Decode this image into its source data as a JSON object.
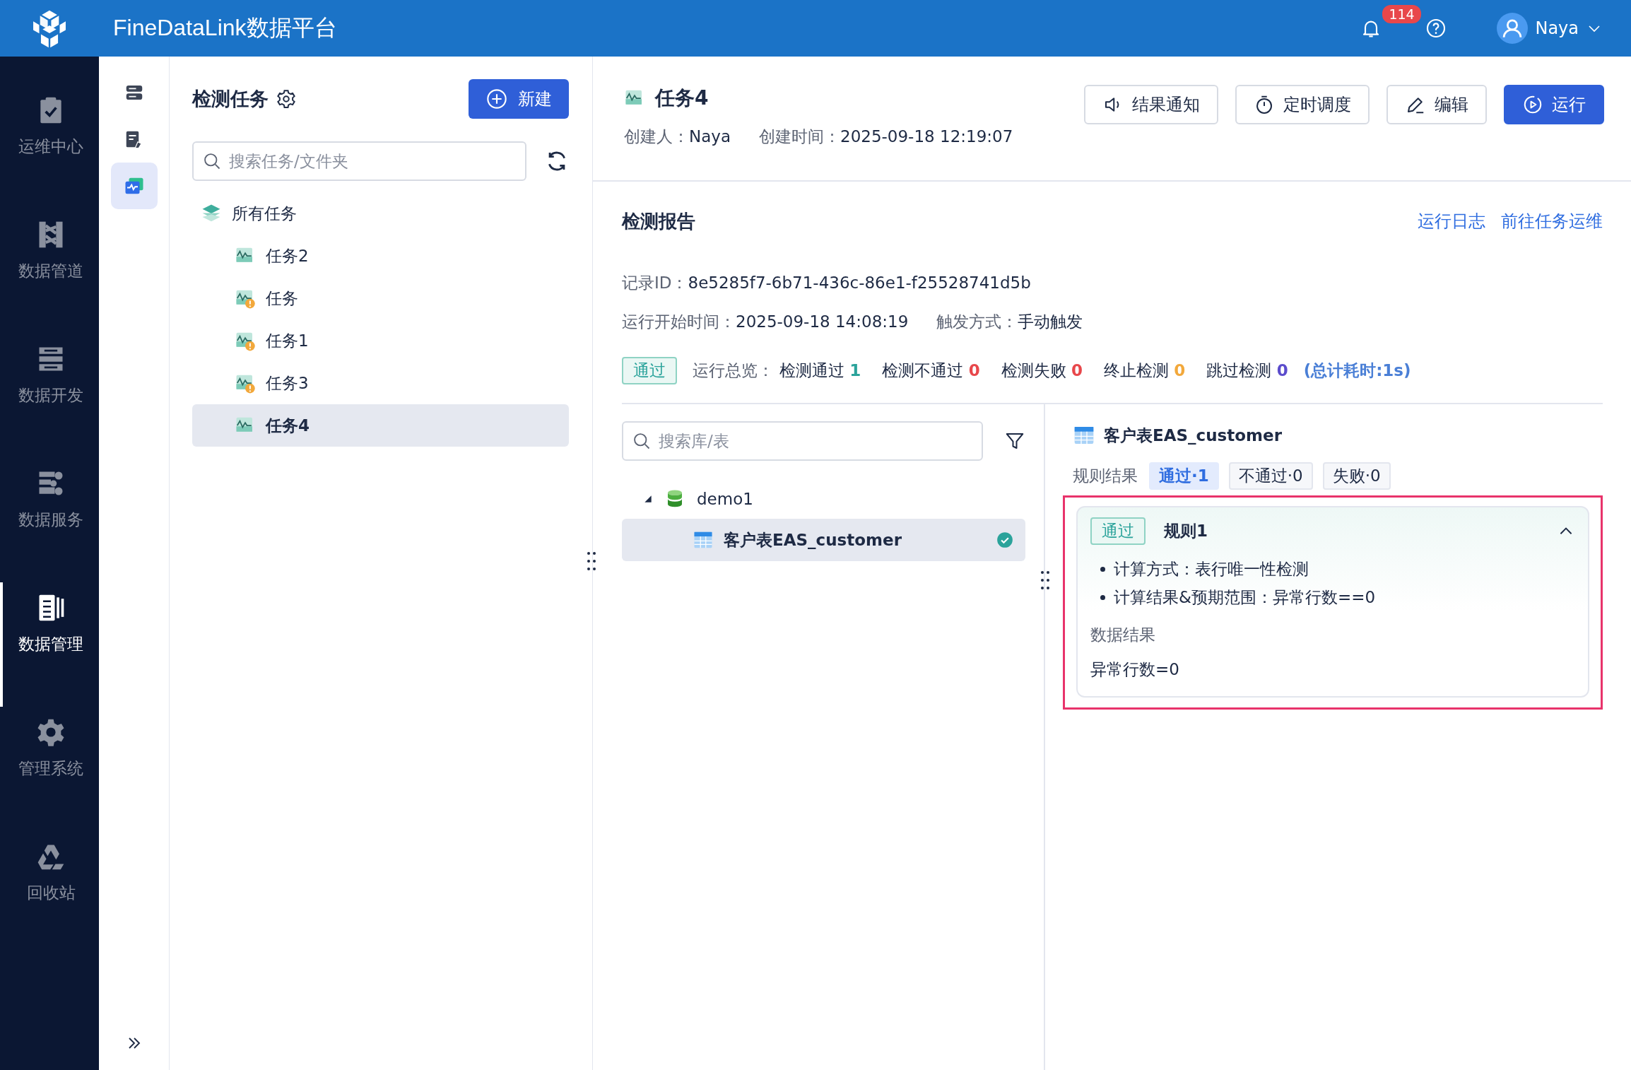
{
  "topbar": {
    "title": "FineDataLink数据平台",
    "notifications": "114",
    "user": "Naya"
  },
  "nav": [
    {
      "label": "运维中心",
      "selected": false
    },
    {
      "label": "数据管道",
      "selected": false
    },
    {
      "label": "数据开发",
      "selected": false
    },
    {
      "label": "数据服务",
      "selected": false
    },
    {
      "label": "数据管理",
      "selected": true
    },
    {
      "label": "管理系统",
      "selected": false
    },
    {
      "label": "回收站",
      "selected": false
    }
  ],
  "subnav": [
    {
      "selected": false
    },
    {
      "selected": false
    },
    {
      "selected": true
    }
  ],
  "task_panel": {
    "title": "检测任务",
    "new_button": "新建",
    "search": {
      "placeholder": "搜索任务/文件夹"
    },
    "tree": {
      "label": "所有任务",
      "children": [
        {
          "label": "任务2",
          "warning": false,
          "selected": false
        },
        {
          "label": "任务",
          "warning": true,
          "selected": false
        },
        {
          "label": "任务1",
          "warning": true,
          "selected": false
        },
        {
          "label": "任务3",
          "warning": true,
          "selected": false
        },
        {
          "label": "任务4",
          "warning": false,
          "selected": true
        }
      ]
    }
  },
  "task": {
    "title": "任务4",
    "meta": [
      {
        "label": "创建人：",
        "value": "Naya"
      },
      {
        "label": "创建时间：",
        "value": "2025-09-18 12:19:07"
      }
    ],
    "buttons": [
      {
        "label": "结果通知",
        "kind": "notify"
      },
      {
        "label": "定时调度",
        "kind": "schedule"
      },
      {
        "label": "编辑",
        "kind": "edit"
      },
      {
        "label": "运行",
        "kind": "run"
      }
    ]
  },
  "report": {
    "title": "检测报告",
    "links": [
      "运行日志",
      "前往任务运维"
    ],
    "fields": [
      [
        {
          "label": "记录ID：",
          "value": "8e5285f7-6b71-436c-86e1-f25528741d5b"
        }
      ],
      [
        {
          "label": "运行开始时间：",
          "value": "2025-09-18 14:08:19"
        },
        {
          "label": "触发方式：",
          "value": "手动触发"
        }
      ]
    ],
    "status": "通过",
    "summary_label": "运行总览：",
    "stats": [
      {
        "label": "检测通过",
        "value": "1",
        "color": "#2ba39b"
      },
      {
        "label": "检测不通过",
        "value": "0",
        "color": "#e8474b"
      },
      {
        "label": "检测失败",
        "value": "0",
        "color": "#e8474b"
      },
      {
        "label": "终止检测",
        "value": "0",
        "color": "#f2a83b"
      },
      {
        "label": "跳过检测",
        "value": "0",
        "color": "#5b4ccc"
      }
    ],
    "total": "(总计耗时:1s)"
  },
  "tables": {
    "search": {
      "placeholder": "搜索库/表"
    },
    "tree": {
      "label": "demo1",
      "expanded": true,
      "children": [
        {
          "label": "客户表EAS_customer",
          "selected": true,
          "passed": true
        }
      ]
    }
  },
  "detail": {
    "title": "客户表EAS_customer",
    "filter_label": "规则结果",
    "chips": [
      {
        "label": "通过·1",
        "selected": true
      },
      {
        "label": "不通过·0",
        "selected": false
      },
      {
        "label": "失败·0",
        "selected": false
      }
    ],
    "rules": [
      {
        "status": "通过",
        "name": "规则1",
        "expanded": true,
        "highlighted": true,
        "bullets": [
          "计算方式：表行唯一性检测",
          "计算结果&预期范围：异常行数==0"
        ],
        "section": "数据结果",
        "result": "异常行数=0"
      }
    ]
  }
}
